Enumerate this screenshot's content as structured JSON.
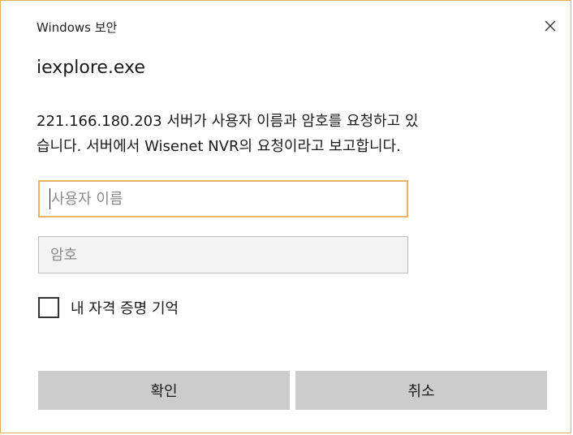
{
  "window": {
    "title": "Windows 보안",
    "close_icon": "close-icon"
  },
  "dialog": {
    "app_name": "iexplore.exe",
    "message_line1": "221.166.180.203 서버가 사용자 이름과 암호를 요청하고 있",
    "message_line2": "습니다. 서버에서 Wisenet NVR의 요청이라고 보고합니다."
  },
  "form": {
    "username_placeholder": "사용자 이름",
    "username_value": "",
    "password_placeholder": "암호",
    "password_value": "",
    "remember_label": "내 자격 증명 기억",
    "remember_checked": false
  },
  "buttons": {
    "ok_label": "확인",
    "cancel_label": "취소"
  },
  "colors": {
    "focus_border": "#e8b36a",
    "window_border": "#e0b062",
    "button_bg": "#cccccc"
  }
}
